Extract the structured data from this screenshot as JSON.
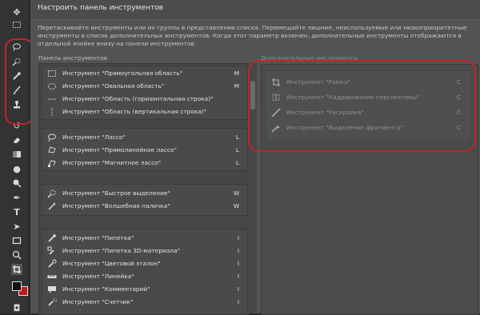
{
  "dialog": {
    "title": "Настроить панель инструментов",
    "description": "Перетаскивайте инструменты или их группы в представлении списка. Перемещайте лишние, неиспользуемые или низкоприоритетные инструменты в список дополнительных инструментов. Когда этот параметр включен, дополнительные инструменты отображаются в отдельной ячейке внизу на панели инструментов.",
    "toolbar_list_label": "Панель инструментов",
    "extra_tools_label": "Дополнительные инструменты"
  },
  "tool_groups": [
    {
      "items": [
        {
          "label": "Инструмент \"Прямоугольная область\"",
          "key": "M",
          "icon": "rect-marquee-icon"
        },
        {
          "label": "Инструмент \"Овальная область\"",
          "key": "M",
          "icon": "ellipse-marquee-icon"
        },
        {
          "label": "Инструмент \"Область (горизонтальная строка)\"",
          "key": "",
          "icon": "row-marquee-icon"
        },
        {
          "label": "Инструмент \"Область (вертикальная строка)\"",
          "key": "",
          "icon": "column-marquee-icon"
        }
      ]
    },
    {
      "items": [
        {
          "label": "Инструмент \"Лассо\"",
          "key": "L",
          "icon": "lasso-icon"
        },
        {
          "label": "Инструмент \"Прямолинейное лассо\"",
          "key": "L",
          "icon": "polygonal-lasso-icon"
        },
        {
          "label": "Инструмент \"Магнитное лассо\"",
          "key": "L",
          "icon": "magnetic-lasso-icon"
        }
      ]
    },
    {
      "items": [
        {
          "label": "Инструмент \"Быстрое выделение\"",
          "key": "W",
          "icon": "quick-selection-icon"
        },
        {
          "label": "Инструмент \"Волшебная палочка\"",
          "key": "W",
          "icon": "magic-wand-icon"
        }
      ]
    },
    {
      "items": [
        {
          "label": "Инструмент \"Пипетка\"",
          "key": "I",
          "icon": "eyedropper-icon"
        },
        {
          "label": "Инструмент \"Пипетка 3D-материала\"",
          "key": "I",
          "icon": "3d-eyedropper-icon"
        },
        {
          "label": "Инструмент \"Цветовой эталон\"",
          "key": "I",
          "icon": "color-sampler-icon"
        },
        {
          "label": "Инструмент \"Линейка\"",
          "key": "I",
          "icon": "ruler-icon"
        },
        {
          "label": "Инструмент \"Комментарий\"",
          "key": "I",
          "icon": "note-icon"
        },
        {
          "label": "Инструмент \"Счетчик\"",
          "key": "I",
          "icon": "count-icon"
        }
      ]
    }
  ],
  "extra_tools": [
    {
      "label": "Инструмент \"Рамка\"",
      "key": "C",
      "icon": "crop-icon"
    },
    {
      "label": "Инструмент \"Кадрирование перспективы\"",
      "key": "C",
      "icon": "perspective-crop-icon"
    },
    {
      "label": "Инструмент \"Раскройка\"",
      "key": "C",
      "icon": "slice-icon"
    },
    {
      "label": "Инструмент \"Выделение фрагмента\"",
      "key": "C",
      "icon": "slice-select-icon"
    }
  ],
  "colors": {
    "highlight": "#c0262a",
    "foreground": "#111111",
    "background": "#c01818"
  }
}
